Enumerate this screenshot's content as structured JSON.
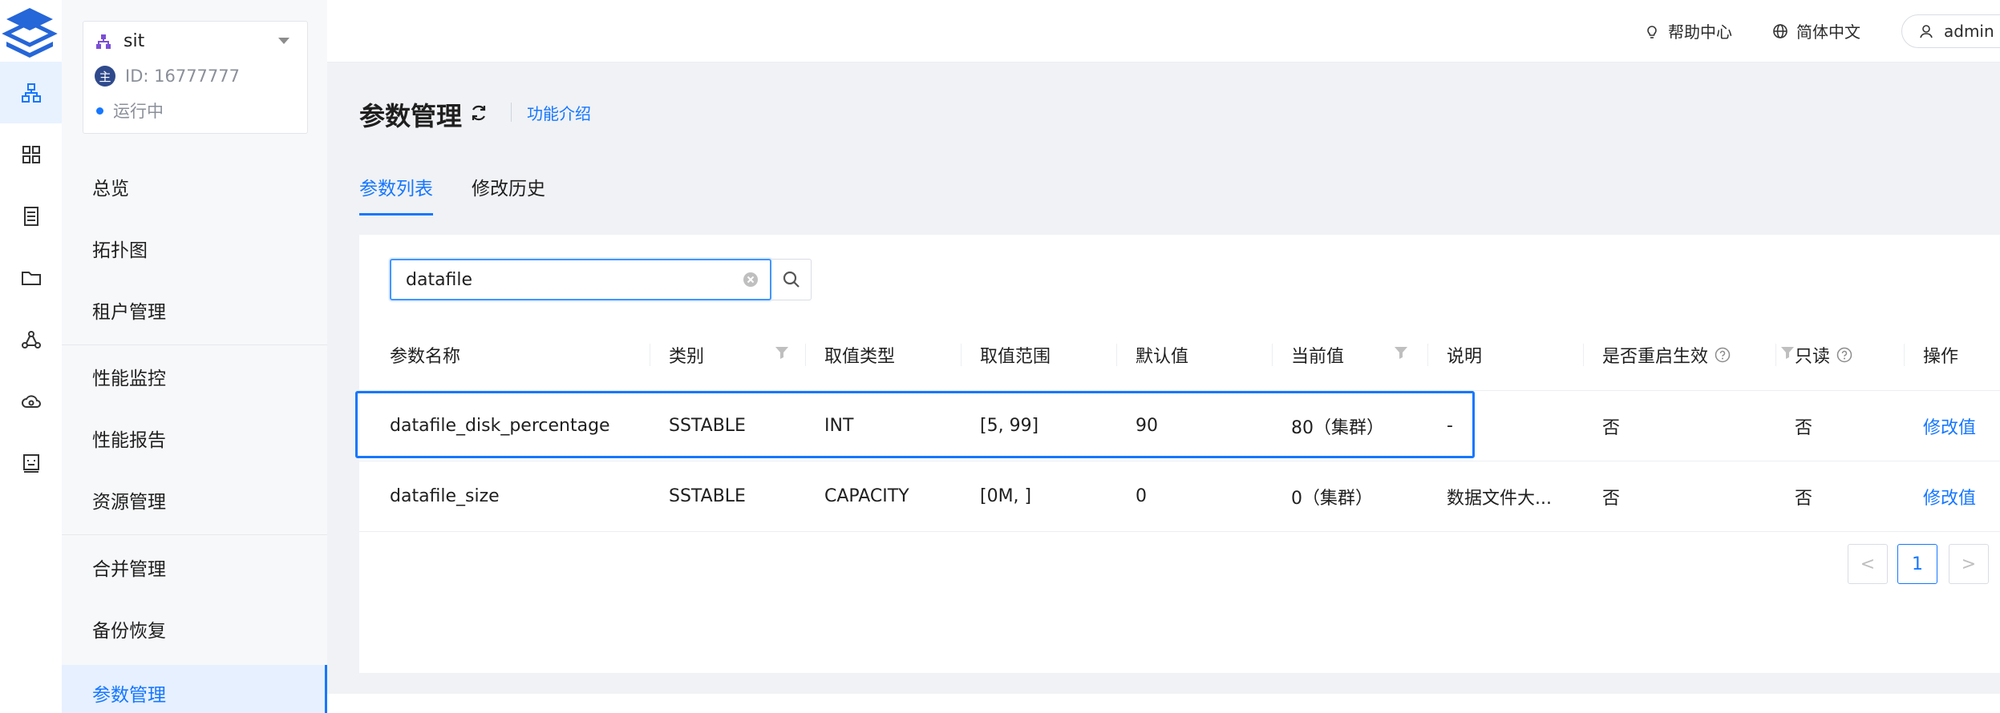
{
  "icon_rail": {
    "logo_icon": "layers-logo-icon",
    "items": [
      {
        "icon": "topology-icon",
        "active": true
      },
      {
        "icon": "grid-icon",
        "active": false
      },
      {
        "icon": "server-icon",
        "active": false
      },
      {
        "icon": "folder-icon",
        "active": false
      },
      {
        "icon": "share-nodes-icon",
        "active": false
      },
      {
        "icon": "cloud-icon",
        "active": false
      },
      {
        "icon": "robot-icon",
        "active": false
      }
    ]
  },
  "cluster": {
    "name": "sit",
    "badge": "主",
    "id_text": "ID: 16777777",
    "status": "运行中"
  },
  "sidebar": {
    "items": [
      {
        "label": "总览"
      },
      {
        "label": "拓扑图"
      },
      {
        "label": "租户管理"
      },
      {
        "label": "性能监控"
      },
      {
        "label": "性能报告"
      },
      {
        "label": "资源管理"
      },
      {
        "label": "合并管理"
      },
      {
        "label": "备份恢复"
      },
      {
        "label": "参数管理",
        "active": true
      }
    ]
  },
  "header": {
    "help": "帮助中心",
    "language": "简体中文",
    "user": "admin"
  },
  "page": {
    "title": "参数管理",
    "intro_link": "功能介绍",
    "tabs": [
      {
        "label": "参数列表",
        "active": true
      },
      {
        "label": "修改历史",
        "active": false
      }
    ]
  },
  "search": {
    "value": "datafile"
  },
  "table": {
    "columns": [
      {
        "label": "参数名称"
      },
      {
        "label": "类别",
        "filter": true
      },
      {
        "label": "取值类型"
      },
      {
        "label": "取值范围"
      },
      {
        "label": "默认值"
      },
      {
        "label": "当前值",
        "filter": true
      },
      {
        "label": "说明"
      },
      {
        "label": "是否重启生效",
        "help": true,
        "filter": true
      },
      {
        "label": "只读",
        "help": true
      },
      {
        "label": "操作"
      }
    ],
    "rows": [
      {
        "name": "datafile_disk_percentage",
        "category": "SSTABLE",
        "value_type": "INT",
        "range": "[5, 99]",
        "default": "90",
        "current": "80（集群）",
        "description": "-",
        "restart": "否",
        "readonly": "否",
        "action": "修改值"
      },
      {
        "name": "datafile_size",
        "category": "SSTABLE",
        "value_type": "CAPACITY",
        "range": "[0M, ]",
        "default": "0",
        "current": "0（集群）",
        "description": "数据文件大...",
        "restart": "否",
        "readonly": "否",
        "action": "修改值"
      }
    ]
  },
  "pagination": {
    "prev": "<",
    "current": "1",
    "next": ">"
  },
  "colors": {
    "primary": "#1677ff",
    "active_bg": "#e6f0ff",
    "content_bg": "#f0f2f5"
  }
}
